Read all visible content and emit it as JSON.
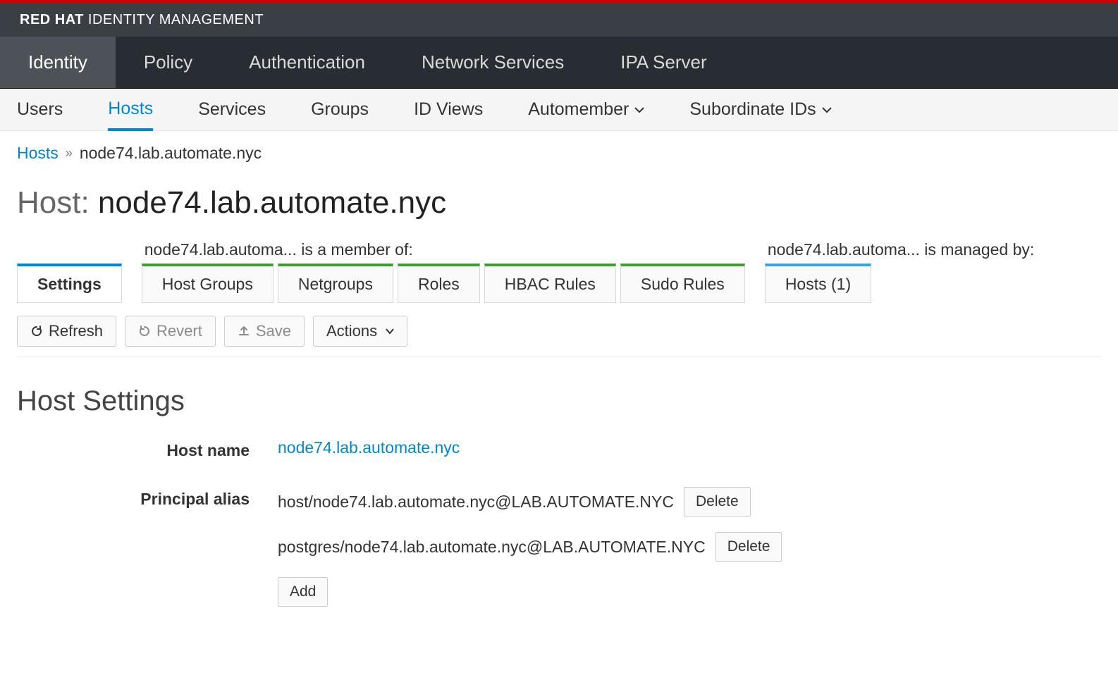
{
  "brand": {
    "strong": "RED HAT",
    "rest": "IDENTITY MANAGEMENT"
  },
  "primaryNav": {
    "items": [
      {
        "label": "Identity",
        "active": true
      },
      {
        "label": "Policy",
        "active": false
      },
      {
        "label": "Authentication",
        "active": false
      },
      {
        "label": "Network Services",
        "active": false
      },
      {
        "label": "IPA Server",
        "active": false
      }
    ]
  },
  "secondaryNav": {
    "items": [
      {
        "label": "Users",
        "active": false,
        "dropdown": false
      },
      {
        "label": "Hosts",
        "active": true,
        "dropdown": false
      },
      {
        "label": "Services",
        "active": false,
        "dropdown": false
      },
      {
        "label": "Groups",
        "active": false,
        "dropdown": false
      },
      {
        "label": "ID Views",
        "active": false,
        "dropdown": false
      },
      {
        "label": "Automember",
        "active": false,
        "dropdown": true
      },
      {
        "label": "Subordinate IDs",
        "active": false,
        "dropdown": true
      }
    ]
  },
  "breadcrumb": {
    "parent": "Hosts",
    "current": "node74.lab.automate.nyc"
  },
  "pageTitle": {
    "prefix": "Host: ",
    "value": "node74.lab.automate.nyc"
  },
  "tabs": {
    "memberOfLabel": "node74.lab.automa... is a member of:",
    "managedByLabel": "node74.lab.automa... is managed by:",
    "settings": "Settings",
    "memberOf": [
      {
        "label": "Host Groups"
      },
      {
        "label": "Netgroups"
      },
      {
        "label": "Roles"
      },
      {
        "label": "HBAC Rules"
      },
      {
        "label": "Sudo Rules"
      }
    ],
    "managedBy": [
      {
        "label": "Hosts (1)"
      }
    ]
  },
  "toolbar": {
    "refresh": "Refresh",
    "revert": "Revert",
    "save": "Save",
    "actions": "Actions"
  },
  "section": {
    "title": "Host Settings"
  },
  "form": {
    "hostNameLabel": "Host name",
    "hostNameValue": "node74.lab.automate.nyc",
    "aliasLabel": "Principal alias",
    "aliases": [
      "host/node74.lab.automate.nyc@LAB.AUTOMATE.NYC",
      "postgres/node74.lab.automate.nyc@LAB.AUTOMATE.NYC"
    ],
    "deleteLabel": "Delete",
    "addLabel": "Add"
  }
}
